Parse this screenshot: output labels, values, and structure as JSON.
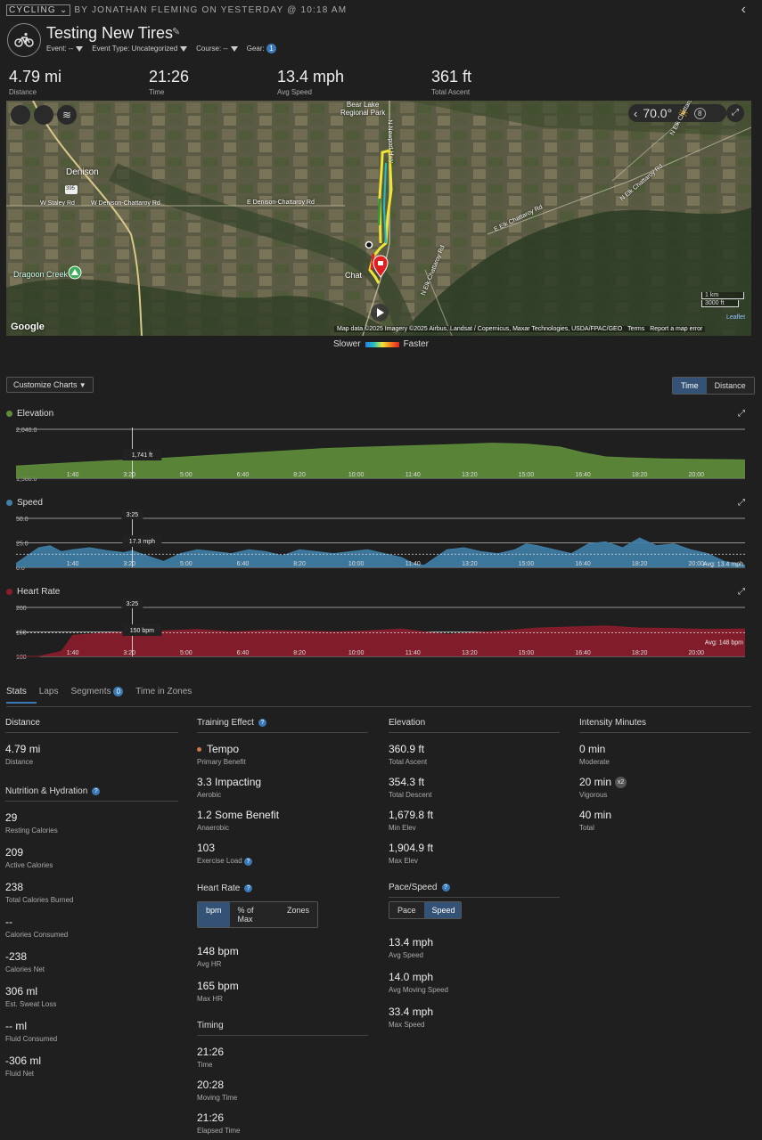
{
  "header": {
    "activity_type": "CYCLING",
    "byline": "BY JONATHAN FLEMING ON YESTERDAY @ 10:18 AM",
    "title": "Testing New Tires",
    "meta": {
      "event": "Event: --",
      "event_type": "Event Type: Uncategorized",
      "course": "Course: --",
      "gear": "Gear:",
      "gear_count": "1"
    }
  },
  "summary": [
    {
      "value": "4.79 mi",
      "label": "Distance"
    },
    {
      "value": "21:26",
      "label": "Time"
    },
    {
      "value": "13.4 mph",
      "label": "Avg Speed"
    },
    {
      "value": "361 ft",
      "label": "Total Ascent"
    }
  ],
  "map": {
    "temperature": "70.0°",
    "weather_badge": "8",
    "place_labels": {
      "denison": "Denison",
      "bear_lake": "Bear Lake",
      "regional_park": "Regional Park",
      "staley": "W Staley Rd",
      "denison_chattaroy_w": "W Denison-Chattaroy Rd",
      "denison_chattaroy_e": "E Denison-Chattaroy Rd",
      "elk_chattaroy_e": "E Elk Chattaroy Rd",
      "elk_chattaroy_n": "N Elk Chattaroy Rd",
      "elk_chattaroy_n2": "N Elk Chattaroy Rd",
      "newport": "N Newport Hwy",
      "dragoon": "Dragoon Creek",
      "chat": "Chat",
      "route_sign": "395"
    },
    "scale": [
      "1 km",
      "3000 ft"
    ],
    "attribution": "Map data ©2025 Imagery ©2025 Airbus, Landsat / Copernicus, Maxar Technologies, USDA/FPAC/GEO",
    "terms": "Terms",
    "report": "Report a map error",
    "leaflet": "Leaflet",
    "google": "Google",
    "legend": {
      "slower": "Slower",
      "faster": "Faster"
    }
  },
  "controls": {
    "customize": "Customize Charts",
    "time": "Time",
    "distance": "Distance"
  },
  "x_ticks": [
    "1:40",
    "3:20",
    "5:00",
    "6:40",
    "8:20",
    "10:00",
    "11:40",
    "13:20",
    "15:00",
    "16:40",
    "18:20",
    "20:00"
  ],
  "chart_data": [
    {
      "type": "area",
      "title": "Elevation",
      "color": "#5e8c3a",
      "ylabels": [
        "2,040.0",
        "1,560.0"
      ],
      "ylim": [
        1560,
        2040
      ],
      "cursor_time": "3:25",
      "cursor_value": "1,741 ft",
      "x": [
        0,
        60,
        120,
        180,
        205,
        240,
        300,
        360,
        420,
        480,
        540,
        600,
        660,
        720,
        780,
        840,
        900,
        960,
        1000,
        1040,
        1080,
        1140,
        1200,
        1260,
        1286
      ],
      "values": [
        1680,
        1700,
        1718,
        1735,
        1741,
        1750,
        1770,
        1790,
        1810,
        1830,
        1850,
        1862,
        1872,
        1882,
        1892,
        1904,
        1895,
        1865,
        1810,
        1770,
        1760,
        1750,
        1745,
        1742,
        1740
      ]
    },
    {
      "type": "area",
      "title": "Speed",
      "color": "#3f7ea6",
      "ylabels": [
        "50.0",
        "25.0",
        "0.0"
      ],
      "ylim": [
        0,
        50
      ],
      "cursor_time": "3:25",
      "cursor_value": "17.3 mph",
      "avg_label": "Avg: 13.4 mph",
      "avg": 13.4,
      "x": [
        0,
        20,
        40,
        60,
        80,
        100,
        130,
        160,
        190,
        205,
        230,
        260,
        290,
        320,
        350,
        380,
        410,
        440,
        470,
        500,
        530,
        560,
        590,
        620,
        650,
        680,
        700,
        720,
        740,
        760,
        790,
        820,
        850,
        880,
        900,
        920,
        950,
        980,
        1010,
        1040,
        1070,
        1100,
        1130,
        1160,
        1190,
        1220,
        1250,
        1286
      ],
      "values": [
        4,
        12,
        20,
        22,
        16,
        18,
        20,
        17,
        15,
        17,
        12,
        6,
        14,
        18,
        16,
        14,
        18,
        16,
        12,
        18,
        16,
        14,
        16,
        18,
        14,
        10,
        4,
        2,
        10,
        18,
        20,
        16,
        14,
        18,
        24,
        22,
        18,
        14,
        24,
        26,
        20,
        30,
        22,
        24,
        18,
        14,
        6,
        2
      ]
    },
    {
      "type": "area",
      "title": "Heart Rate",
      "color": "#8a1d2b",
      "ylabels": [
        "200",
        "150",
        "100"
      ],
      "ylim": [
        100,
        200
      ],
      "cursor_time": "3:25",
      "cursor_value": "150 bpm",
      "avg_label": "Avg: 148 bpm",
      "avg": 148,
      "x": [
        0,
        40,
        80,
        100,
        160,
        205,
        260,
        320,
        380,
        440,
        500,
        560,
        620,
        680,
        720,
        760,
        800,
        860,
        920,
        980,
        1040,
        1100,
        1160,
        1220,
        1286
      ],
      "values": [
        100,
        100,
        110,
        143,
        148,
        150,
        152,
        155,
        150,
        153,
        152,
        150,
        152,
        156,
        150,
        145,
        148,
        152,
        158,
        160,
        162,
        158,
        157,
        155,
        156
      ]
    }
  ],
  "tabs": {
    "stats": "Stats",
    "laps": "Laps",
    "segments": "Segments",
    "segments_count": "0",
    "zones": "Time in Zones"
  },
  "stats": {
    "distance": {
      "title": "Distance",
      "items": [
        {
          "value": "4.79 mi",
          "label": "Distance"
        }
      ]
    },
    "nutrition": {
      "title": "Nutrition & Hydration",
      "items": [
        {
          "value": "29",
          "label": "Resting Calories"
        },
        {
          "value": "209",
          "label": "Active Calories"
        },
        {
          "value": "238",
          "label": "Total Calories Burned"
        },
        {
          "value": "--",
          "label": "Calories Consumed"
        },
        {
          "value": "-238",
          "label": "Calories Net"
        },
        {
          "value": "306 ml",
          "label": "Est. Sweat Loss"
        },
        {
          "value": "-- ml",
          "label": "Fluid Consumed"
        },
        {
          "value": "-306 ml",
          "label": "Fluid Net"
        }
      ]
    },
    "training": {
      "title": "Training Effect",
      "items": [
        {
          "value": "Tempo",
          "label": "Primary Benefit"
        },
        {
          "value": "3.3 Impacting",
          "label": "Aerobic"
        },
        {
          "value": "1.2 Some Benefit",
          "label": "Anaerobic"
        },
        {
          "value": "103",
          "label": "Exercise Load"
        }
      ]
    },
    "heart": {
      "title": "Heart Rate",
      "toggles": [
        "bpm",
        "% of Max",
        "Zones"
      ],
      "items": [
        {
          "value": "148 bpm",
          "label": "Avg HR"
        },
        {
          "value": "165 bpm",
          "label": "Max HR"
        }
      ]
    },
    "timing": {
      "title": "Timing",
      "items": [
        {
          "value": "21:26",
          "label": "Time"
        },
        {
          "value": "20:28",
          "label": "Moving Time"
        },
        {
          "value": "21:26",
          "label": "Elapsed Time"
        }
      ]
    },
    "elevation": {
      "title": "Elevation",
      "items": [
        {
          "value": "360.9 ft",
          "label": "Total Ascent"
        },
        {
          "value": "354.3 ft",
          "label": "Total Descent"
        },
        {
          "value": "1,679.8 ft",
          "label": "Min Elev"
        },
        {
          "value": "1,904.9 ft",
          "label": "Max Elev"
        }
      ]
    },
    "pace": {
      "title": "Pace/Speed",
      "toggles": [
        "Pace",
        "Speed"
      ],
      "items": [
        {
          "value": "13.4 mph",
          "label": "Avg Speed"
        },
        {
          "value": "14.0 mph",
          "label": "Avg Moving Speed"
        },
        {
          "value": "33.4 mph",
          "label": "Max Speed"
        }
      ]
    },
    "intensity": {
      "title": "Intensity Minutes",
      "items": [
        {
          "value": "0 min",
          "label": "Moderate"
        },
        {
          "value": "20 min",
          "label": "Vigorous",
          "badge": "x2"
        },
        {
          "value": "40 min",
          "label": "Total"
        }
      ]
    }
  }
}
